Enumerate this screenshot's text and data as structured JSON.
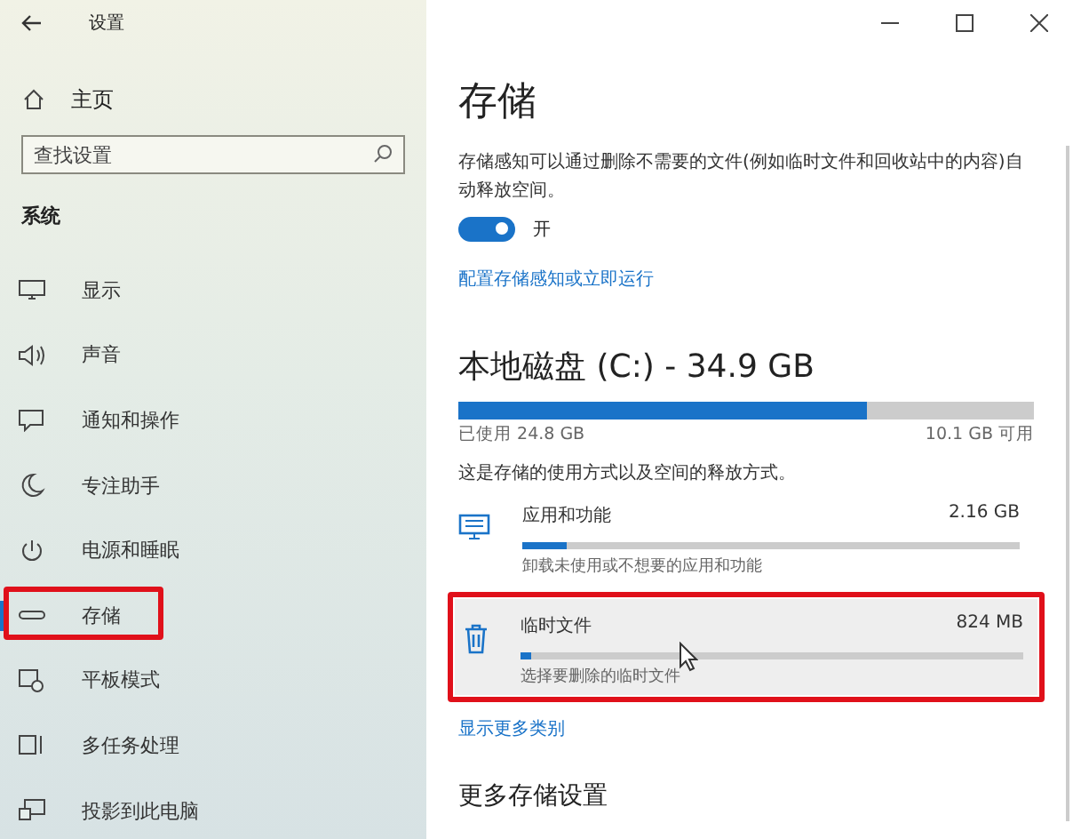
{
  "window": {
    "title": "设置"
  },
  "sidebar": {
    "home": "主页",
    "search": {
      "placeholder": "查找设置"
    },
    "section": "系统",
    "items": [
      {
        "label": "显示",
        "selected": false,
        "outlined": false
      },
      {
        "label": "声音",
        "selected": false,
        "outlined": false
      },
      {
        "label": "通知和操作",
        "selected": false,
        "outlined": false
      },
      {
        "label": "专注助手",
        "selected": false,
        "outlined": false
      },
      {
        "label": "电源和睡眠",
        "selected": false,
        "outlined": false
      },
      {
        "label": "存储",
        "selected": true,
        "outlined": true
      },
      {
        "label": "平板模式",
        "selected": false,
        "outlined": false
      },
      {
        "label": "多任务处理",
        "selected": false,
        "outlined": false
      },
      {
        "label": "投影到此电脑",
        "selected": false,
        "outlined": false
      }
    ]
  },
  "main": {
    "title": "存储",
    "description": "存储感知可以通过删除不需要的文件(例如临时文件和回收站中的内容)自动释放空间。",
    "toggle": {
      "on": true,
      "label": "开"
    },
    "link": "配置存储感知或立即运行",
    "disk": {
      "title": "本地磁盘 (C:) - 34.9 GB",
      "level": 0.71,
      "used": "已使用 24.8 GB",
      "free": "10.1 GB 可用"
    },
    "usage_note": "这是存储的使用方式以及空间的释放方式。",
    "categories": [
      {
        "kind": "apps",
        "name": "应用和功能",
        "size": "2.16 GB",
        "level": 0.09,
        "hint": "卸载未使用或不想要的应用和功能",
        "hovered": false,
        "outlined": false
      },
      {
        "kind": "temp",
        "name": "临时文件",
        "size": "824 MB",
        "level": 0.02,
        "hint": "选择要删除的临时文件",
        "hovered": true,
        "outlined": true
      }
    ],
    "more_link": "显示更多类别",
    "more_heading": "更多存储设置"
  }
}
